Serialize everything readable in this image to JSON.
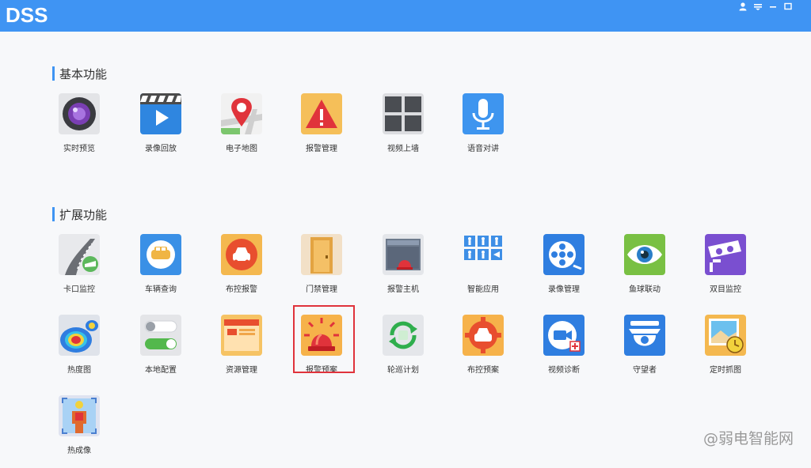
{
  "app": {
    "title": "DSS"
  },
  "window_controls": [
    {
      "name": "user-icon"
    },
    {
      "name": "menu-icon"
    },
    {
      "name": "minimize-icon"
    },
    {
      "name": "maximize-icon"
    }
  ],
  "sections": {
    "basic": {
      "title": "基本功能"
    },
    "extended": {
      "title": "扩展功能"
    }
  },
  "basic_items": [
    {
      "label": "实时预览",
      "icon": "camera-lens-icon"
    },
    {
      "label": "录像回放",
      "icon": "video-playback-icon"
    },
    {
      "label": "电子地图",
      "icon": "map-pin-icon"
    },
    {
      "label": "报警管理",
      "icon": "warning-triangle-icon"
    },
    {
      "label": "视频上墙",
      "icon": "video-wall-icon"
    },
    {
      "label": "语音对讲",
      "icon": "microphone-icon"
    }
  ],
  "extended_items": [
    {
      "label": "卡口监控",
      "icon": "road-checkpoint-icon"
    },
    {
      "label": "车辆查询",
      "icon": "vehicle-search-icon"
    },
    {
      "label": "布控报警",
      "icon": "car-alarm-icon"
    },
    {
      "label": "门禁管理",
      "icon": "door-icon"
    },
    {
      "label": "报警主机",
      "icon": "alarm-host-icon"
    },
    {
      "label": "智能应用",
      "icon": "smart-app-icon"
    },
    {
      "label": "录像管理",
      "icon": "film-reel-icon"
    },
    {
      "label": "鱼球联动",
      "icon": "eye-icon"
    },
    {
      "label": "双目监控",
      "icon": "binocular-camera-icon"
    },
    {
      "label": "热度图",
      "icon": "heatmap-icon"
    },
    {
      "label": "本地配置",
      "icon": "toggle-switches-icon"
    },
    {
      "label": "资源管理",
      "icon": "resource-folder-icon"
    },
    {
      "label": "报警预案",
      "icon": "alarm-siren-icon"
    },
    {
      "label": "轮巡计划",
      "icon": "cycle-refresh-icon"
    },
    {
      "label": "布控预案",
      "icon": "gear-car-icon"
    },
    {
      "label": "视频诊断",
      "icon": "video-diagnosis-icon"
    },
    {
      "label": "守望者",
      "icon": "ptz-dome-icon"
    },
    {
      "label": "定时抓图",
      "icon": "timed-capture-icon"
    },
    {
      "label": "热成像",
      "icon": "thermal-body-icon"
    }
  ],
  "watermark": "@弱电智能网",
  "highlighted_item": "报警预案"
}
